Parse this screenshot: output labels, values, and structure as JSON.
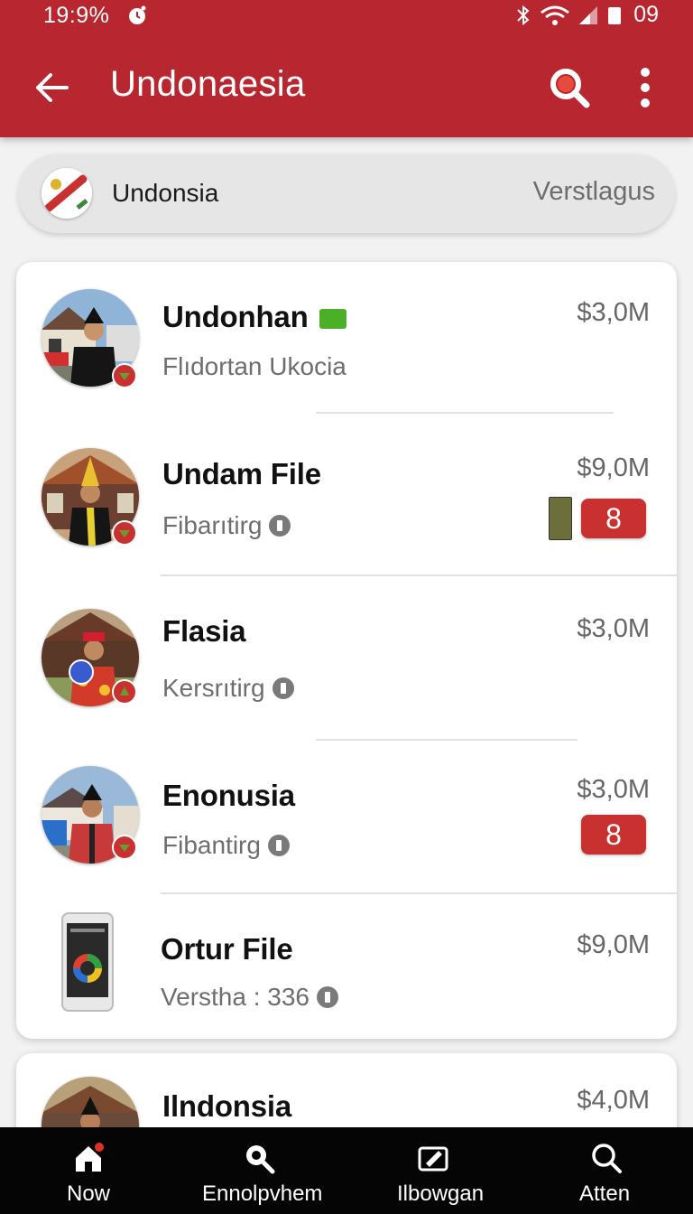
{
  "status_bar": {
    "time": "19:9%",
    "battery_text": "09"
  },
  "app_bar": {
    "title": "Undonaesia"
  },
  "search": {
    "value": "Undonsia",
    "aux_label": "Verstlagus"
  },
  "items": [
    {
      "name": "Undonhan",
      "subtitle": "Flıdortan Ukocia",
      "price": "$3,0M",
      "badge": ""
    },
    {
      "name": "Undam File",
      "subtitle": "Fibarıtirg",
      "price": "$9,0M",
      "badge": "8"
    },
    {
      "name": "Flasia",
      "subtitle": "Kersrıtirg",
      "price": "$3,0M",
      "badge": ""
    },
    {
      "name": "Enonusia",
      "subtitle": "Fibantirg",
      "price": "$3,0M",
      "badge": "8"
    },
    {
      "name": "Ortur File",
      "subtitle": "Verstha : 336",
      "price": "$9,0M",
      "badge": ""
    },
    {
      "name": "Ilndonsia",
      "subtitle": "",
      "price": "$4,0M",
      "badge": ""
    }
  ],
  "bottom_nav": [
    {
      "label": "Now",
      "icon": "home-icon"
    },
    {
      "label": "Ennolpvhem",
      "icon": "search-icon"
    },
    {
      "label": "Ilbowgan",
      "icon": "edit-icon"
    },
    {
      "label": "Atten",
      "icon": "search-icon"
    }
  ],
  "colors": {
    "brand": "#b8262f",
    "badge": "#c8312f",
    "nav_bg": "#050505"
  }
}
